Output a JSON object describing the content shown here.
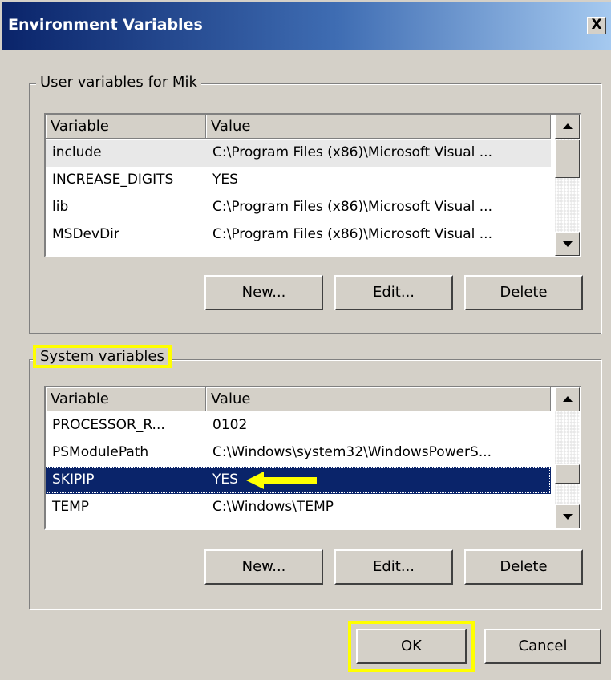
{
  "window": {
    "title": "Environment Variables",
    "close_label": "X"
  },
  "user_group": {
    "legend": "User variables for Mik",
    "columns": [
      "Variable",
      "Value"
    ],
    "rows": [
      {
        "variable": "include",
        "value": "C:\\Program Files (x86)\\Microsoft Visual ..."
      },
      {
        "variable": "INCREASE_DIGITS",
        "value": "YES"
      },
      {
        "variable": "lib",
        "value": "C:\\Program Files (x86)\\Microsoft Visual ..."
      },
      {
        "variable": "MSDevDir",
        "value": "C:\\Program Files (x86)\\Microsoft Visual ..."
      }
    ],
    "buttons": {
      "new": "New...",
      "edit": "Edit...",
      "delete": "Delete"
    }
  },
  "system_group": {
    "legend": "System variables",
    "columns": [
      "Variable",
      "Value"
    ],
    "rows": [
      {
        "variable": "PROCESSOR_R...",
        "value": "0102"
      },
      {
        "variable": "PSModulePath",
        "value": "C:\\Windows\\system32\\WindowsPowerS..."
      },
      {
        "variable": "SKIPIP",
        "value": "YES"
      },
      {
        "variable": "TEMP",
        "value": "C:\\Windows\\TEMP"
      }
    ],
    "buttons": {
      "new": "New...",
      "edit": "Edit...",
      "delete": "Delete"
    }
  },
  "footer": {
    "ok": "OK",
    "cancel": "Cancel"
  },
  "colors": {
    "highlight": "#ffff00",
    "selection": "#0a246a",
    "face": "#d4d0c8"
  }
}
